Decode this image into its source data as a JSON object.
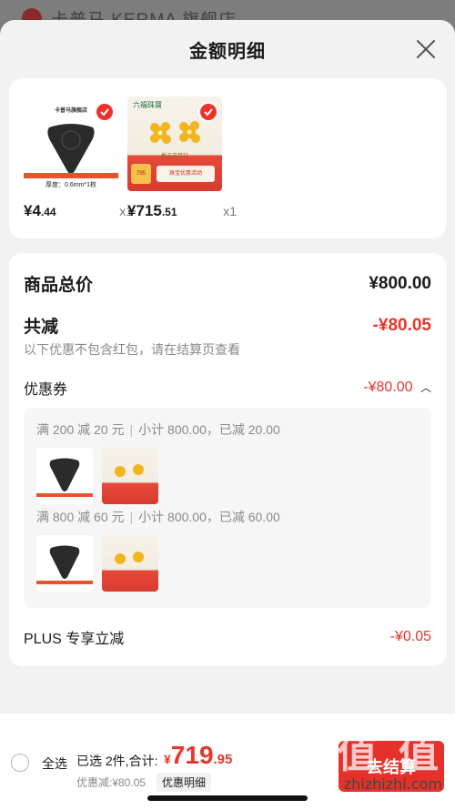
{
  "background": {
    "store_name": "卡普马 KERMA 旗舰店"
  },
  "sheet": {
    "title": "金额明细"
  },
  "products": [
    {
      "brand": "卡普马旗舰店",
      "spec": "厚度：0.6mm*1枚",
      "price_int": "¥4",
      "price_dec": ".44",
      "qty": "x1"
    },
    {
      "brand": "六福珠寶",
      "caption": "栀子花耳钉",
      "badge": "795",
      "promo": "珠宝优惠活动",
      "price_int": "¥715",
      "price_dec": ".51",
      "qty": "x1"
    }
  ],
  "summary": {
    "total_label": "商品总价",
    "total_value": "¥800.00",
    "reduce_label": "共减",
    "reduce_value": "-¥80.05",
    "hint": "以下优惠不包含红包，请在结算页查看",
    "coupon_label": "优惠券",
    "coupon_value": "-¥80.00",
    "coupons": [
      {
        "rule": "满 200 减 20 元",
        "detail": "小计 800.00，已减 20.00"
      },
      {
        "rule": "满 800 减 60 元",
        "detail": "小计 800.00，已减 60.00"
      }
    ],
    "plus_label": "PLUS 专享立减",
    "plus_value": "-¥0.05"
  },
  "bottom": {
    "select_all": "全选",
    "selected": "已选 2件,合计:",
    "total_sym": "¥",
    "total_int": "719",
    "total_dec": ".95",
    "discount": "优惠减:¥80.05",
    "detail_tag": "优惠明细",
    "checkout": "去结算"
  },
  "watermark": {
    "text": "值 值 值",
    "url": "zhizhizhi.com"
  },
  "colors": {
    "accent": "#e4322b",
    "sheet_bg": "#f2f2f2",
    "card_bg": "#ffffff"
  }
}
